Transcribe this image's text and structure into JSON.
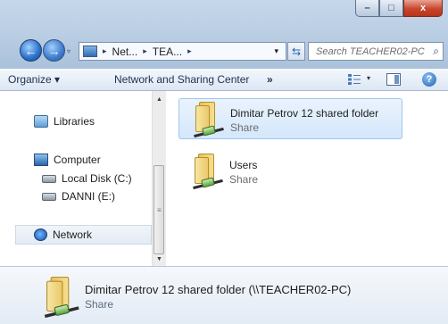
{
  "window": {
    "caption_buttons": {
      "minimize": "–",
      "maximize": "□",
      "close": "x"
    }
  },
  "address_bar": {
    "segments": [
      "Net...",
      "TEA..."
    ],
    "separator": "▸",
    "dropdown_arrow": "▾",
    "refresh_glyph": "⇆"
  },
  "search": {
    "placeholder": "Search TEACHER02-PC",
    "glyph": "⌕"
  },
  "nav_buttons": {
    "back": "←",
    "forward": "→",
    "recent": "▿"
  },
  "toolbar": {
    "organize_label": "Organize ▾",
    "network_sharing_label": "Network and Sharing Center",
    "more_label": "»",
    "view_dropdown": "▾",
    "help_label": "?"
  },
  "nav_pane": {
    "items": [
      {
        "label": "Libraries",
        "icon": "libraries-icon"
      },
      {
        "label": "Computer",
        "icon": "computer-icon"
      },
      {
        "label": "Local Disk (C:)",
        "icon": "local-disk-icon"
      },
      {
        "label": "DANNI (E:)",
        "icon": "removable-disk-icon"
      },
      {
        "label": "Network",
        "icon": "network-icon"
      }
    ],
    "scroll_up": "▲",
    "scroll_down": "▼",
    "scroll_grip": "≡"
  },
  "files": [
    {
      "name": "Dimitar Petrov 12 shared folder",
      "type": "Share",
      "selected": true
    },
    {
      "name": "Users",
      "type": "Share",
      "selected": false
    }
  ],
  "details": {
    "title": "Dimitar Petrov 12 shared folder (\\\\TEACHER02-PC)",
    "subtitle": "Share"
  },
  "colors": {
    "selection": "#d4e7fb",
    "accent": "#2a6fc9",
    "close_button": "#c9462c"
  }
}
